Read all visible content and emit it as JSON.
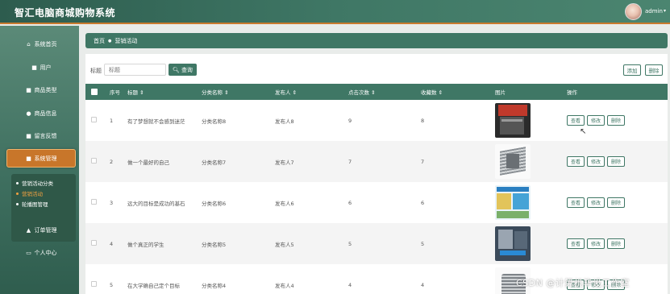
{
  "header": {
    "title": "智汇电脑商城购物系统",
    "user": "admin"
  },
  "sidebar": {
    "items": [
      {
        "label": "系统首页",
        "icon": "home-icon"
      },
      {
        "label": "用户",
        "icon": "grid-icon"
      },
      {
        "label": "商品类型",
        "icon": "grid-icon"
      },
      {
        "label": "商品信息",
        "icon": "user-icon"
      },
      {
        "label": "留言反馈",
        "icon": "grid-icon"
      },
      {
        "label": "系统管理",
        "icon": "grid-icon",
        "active": true
      },
      {
        "label": "订单管理",
        "icon": "thumb-icon"
      },
      {
        "label": "个人中心",
        "icon": "box-icon"
      }
    ],
    "submenu": [
      "营销活动分类",
      "营销活动",
      "轮播图管理"
    ],
    "submenu_active": "营销活动"
  },
  "breadcrumb": {
    "home": "首页",
    "current": "营销活动"
  },
  "search": {
    "label": "标题",
    "placeholder": "标题",
    "button": "查询"
  },
  "toolbar": {
    "add": "添加",
    "delete": "删除"
  },
  "table": {
    "headers": [
      "序号",
      "标题 ⇕",
      "分类名称 ⇕",
      "发布人 ⇕",
      "点击次数 ⇕",
      "收藏数 ⇕",
      "图片",
      "操作"
    ],
    "rows": [
      {
        "no": "1",
        "title": "有了梦想就不会感到迷茫",
        "category": "分类名称8",
        "publisher": "发布人8",
        "clicks": "9",
        "favorites": "8"
      },
      {
        "no": "2",
        "title": "做一个最好的自己",
        "category": "分类名称7",
        "publisher": "发布人7",
        "clicks": "7",
        "favorites": "7"
      },
      {
        "no": "3",
        "title": "远大的目标是成功的基石",
        "category": "分类名称6",
        "publisher": "发布人6",
        "clicks": "6",
        "favorites": "6"
      },
      {
        "no": "4",
        "title": "做个真正的学生",
        "category": "分类名称5",
        "publisher": "发布人5",
        "clicks": "5",
        "favorites": "5"
      },
      {
        "no": "5",
        "title": "在大学确自己定个目标",
        "category": "分类名称4",
        "publisher": "发布人4",
        "clicks": "4",
        "favorites": "4"
      }
    ],
    "actions": {
      "view": "查看",
      "edit": "修改",
      "delete": "删除"
    }
  },
  "watermark": "CSDN @计算机毕设工作室",
  "colors": {
    "primary": "#3f7765",
    "accent": "#c8762a"
  }
}
